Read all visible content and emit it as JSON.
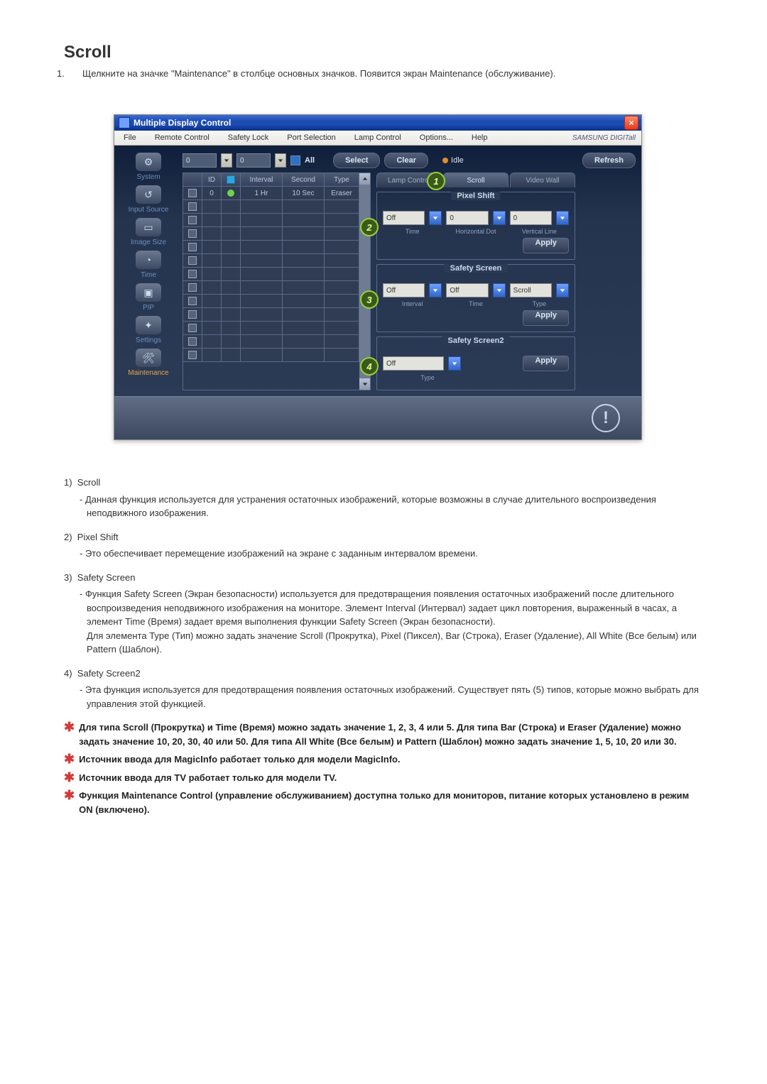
{
  "heading": "Scroll",
  "intro": "Щелкните на значке \"Maintenance\" в столбце основных значков. Появится экран Maintenance (обслуживание).",
  "app": {
    "title": "Multiple Display Control",
    "brand": "SAMSUNG DIGITall",
    "menu": [
      "File",
      "Remote Control",
      "Safety Lock",
      "Port Selection",
      "Lamp Control",
      "Options...",
      "Help"
    ],
    "sidebar": [
      {
        "label": "System",
        "glyph": "⚙"
      },
      {
        "label": "Input Source",
        "glyph": "↺"
      },
      {
        "label": "Image Size",
        "glyph": "▭"
      },
      {
        "label": "Time",
        "glyph": "◔"
      },
      {
        "label": "PIP",
        "glyph": "▣"
      },
      {
        "label": "Settings",
        "glyph": "✦"
      },
      {
        "label": "Maintenance",
        "glyph": "🛠",
        "active": true
      }
    ],
    "toolbar": {
      "field1": "0",
      "field2": "0",
      "all": "All",
      "select": "Select",
      "clear": "Clear",
      "idle": "Idle",
      "refresh": "Refresh"
    },
    "table": {
      "headers": [
        "",
        "ID",
        "",
        "Interval",
        "Second",
        "Type"
      ],
      "row0": {
        "checked": true,
        "id": "0",
        "dot": "green",
        "interval": "1 Hr",
        "second": "10 Sec",
        "type": "Eraser"
      }
    },
    "tabs": {
      "lamp": "Lamp Control",
      "scroll": "Scroll",
      "video": "Video Wall",
      "callout": "1"
    },
    "groups": {
      "pixel": {
        "title": "Pixel Shift",
        "callout": "2",
        "sel": [
          "Off",
          "0",
          "0"
        ],
        "caps": [
          "Time",
          "Horizontal Dot",
          "Vertical Line"
        ],
        "apply": "Apply"
      },
      "safety": {
        "title": "Safety Screen",
        "callout": "3",
        "sel": [
          "Off",
          "Off",
          "Scroll"
        ],
        "caps": [
          "Interval",
          "Time",
          "Type"
        ],
        "apply": "Apply"
      },
      "safety2": {
        "title": "Safety Screen2",
        "callout": "4",
        "sel": [
          "Off"
        ],
        "caps": [
          "Type"
        ],
        "apply": "Apply"
      }
    },
    "excl": "!"
  },
  "desc": [
    {
      "n": "1)",
      "t": "Scroll",
      "b": "- Данная функция используется для устранения остаточных изображений, которые возможны в случае длительного воспроизведения неподвижного изображения."
    },
    {
      "n": "2)",
      "t": "Pixel Shift",
      "b": "- Это обеспечивает перемещение изображений на экране с заданным интервалом времени."
    },
    {
      "n": "3)",
      "t": "Safety Screen",
      "b": "- Функция Safety Screen (Экран безопасности) используется для предотвращения появления остаточных изображений после длительного воспроизведения неподвижного изображения на мониторе.  Элемент Interval (Интервал) задает цикл повторения, выраженный в часах, а элемент Time (Время) задает время выполнения функции Safety Screen (Экран безопасности).\nДля элемента Type (Тип) можно задать значение Scroll (Прокрутка), Pixel (Пиксел), Bar (Строка), Eraser (Удаление), All White (Все белым) или Pattern (Шаблон)."
    },
    {
      "n": "4)",
      "t": "Safety Screen2",
      "b": "- Эта функция используется для предотвращения появления остаточных изображений. Существует пять (5) типов, которые можно выбрать для управления этой функцией."
    }
  ],
  "notes": [
    "Для типа Scroll (Прокрутка) и Time (Время) можно задать значение 1, 2, 3, 4 или 5. Для типа Bar (Строка) и Eraser (Удаление) можно задать значение 10, 20, 30, 40 или 50. Для типа All White (Все белым) и Pattern (Шаблон) можно задать значение 1, 5, 10, 20 или 30.",
    "Источник ввода для MagicInfo работает только для модели MagicInfo.",
    "Источник ввода для TV работает только для модели TV.",
    "Функция Maintenance Control (управление обслуживанием) доступна только для мониторов, питание которых установлено в режим ON (включено)."
  ]
}
